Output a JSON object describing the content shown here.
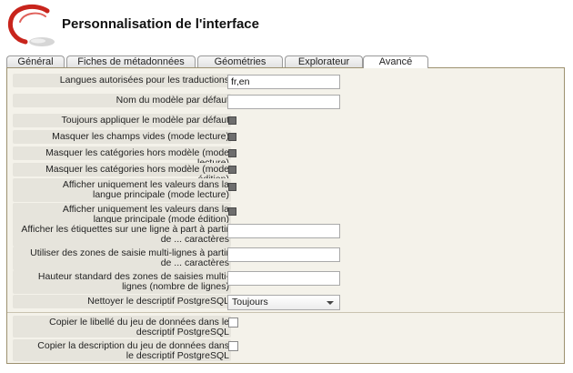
{
  "header": {
    "title": "Personnalisation de l'interface"
  },
  "tabs": [
    {
      "label": "Général"
    },
    {
      "label": "Fiches de métadonnées"
    },
    {
      "label": "Géométries"
    },
    {
      "label": "Explorateur"
    },
    {
      "label": "Avancé"
    }
  ],
  "active_tab": "Avancé",
  "settings": {
    "langues": {
      "label": "Langues autorisées pour les traductions",
      "value": "fr,en"
    },
    "modele": {
      "label": "Nom du modèle par défaut",
      "value": ""
    },
    "toujours_modele": {
      "label": "Toujours appliquer le modèle par défaut",
      "checked": true
    },
    "masquer_vides": {
      "label": "Masquer les champs vides (mode lecture)",
      "checked": true
    },
    "masquer_cat_lecture": {
      "label": "Masquer les catégories hors modèle (mode lecture)",
      "checked": true
    },
    "masquer_cat_edition": {
      "label": "Masquer les catégories hors modèle (mode édition)",
      "checked": true
    },
    "langue_lecture": {
      "label": "Afficher uniquement les valeurs dans la langue principale (mode lecture)",
      "checked": true
    },
    "langue_edition": {
      "label": "Afficher uniquement les valeurs dans la langue principale (mode édition)",
      "checked": true
    },
    "etiquettes": {
      "label": "Afficher les étiquettes sur une ligne à part à partir de ... caractères",
      "value": ""
    },
    "multilignes": {
      "label": "Utiliser des zones de saisie multi-lignes à partir de ... caractères",
      "value": ""
    },
    "hauteur": {
      "label": "Hauteur standard des zones de saisies multi-lignes (nombre de lignes)",
      "value": ""
    },
    "nettoyer": {
      "label": "Nettoyer le descriptif PostgreSQL",
      "selected": "Toujours"
    },
    "copier_libelle": {
      "label": "Copier le libellé du jeu de données dans le descriptif PostgreSQL",
      "checked": false
    },
    "copier_description": {
      "label": "Copier la description du jeu de données dans le descriptif PostgreSQL",
      "checked": false
    }
  },
  "colors": {
    "logo_red": "#c8241c",
    "panel_border": "#9d9170",
    "panel_bg": "#f4f2ea"
  }
}
